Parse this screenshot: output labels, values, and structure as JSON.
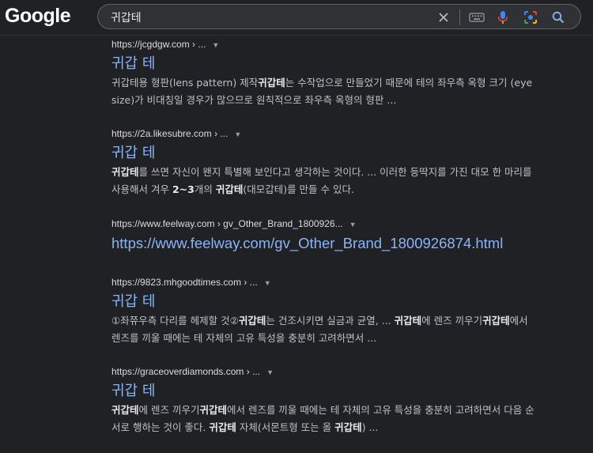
{
  "header": {
    "logo_text": "Google",
    "search_value": "귀갑테",
    "icons": [
      "clear-icon",
      "keyboard-icon",
      "microphone-icon",
      "lens-icon",
      "search-icon"
    ]
  },
  "results": [
    {
      "cite_url": "https://jcgdgw.com",
      "cite_suffix": " › ...",
      "title": "귀갑 테",
      "snippet": [
        {
          "t": "귀갑테용 형판(lens pattern) 제작",
          "b": false
        },
        {
          "t": "귀갑테",
          "b": true
        },
        {
          "t": "는 수작업으로 만들었기 때문에 테의 좌우측 옥형 크기 (eye size)가 비대칭일 경우가 많으므로 원칙적으로 좌우측 옥형의 형판 ...",
          "b": false
        }
      ]
    },
    {
      "cite_url": "https://2a.likesubre.com",
      "cite_suffix": " › ...",
      "title": "귀갑 테",
      "snippet": [
        {
          "t": "귀갑테",
          "b": true
        },
        {
          "t": "를 쓰면 자신이 왠지 특별해 보인다고 생각하는 것이다. ... 이러한 등딱지를 가진 대모 한 마리를 사용해서 겨우 ",
          "b": false
        },
        {
          "t": "2~3",
          "b": true
        },
        {
          "t": "개의 ",
          "b": false
        },
        {
          "t": "귀갑테",
          "b": true
        },
        {
          "t": "(대모갑테)를 만들 수 있다.",
          "b": false
        }
      ]
    },
    {
      "cite_url": "https://www.feelway.com",
      "cite_suffix": " › gv_Other_Brand_1800926...",
      "title": "https://www.feelway.com/gv_Other_Brand_1800926874.html",
      "snippet": []
    },
    {
      "cite_url": "https://9823.mhgoodtimes.com",
      "cite_suffix": " › ...",
      "title": "귀갑 테",
      "snippet": [
        {
          "t": "①좌쮸우측 다리를 헤제할 것②",
          "b": false
        },
        {
          "t": "귀갑테",
          "b": true
        },
        {
          "t": "는 건조시키면 실금과 균열, ... ",
          "b": false
        },
        {
          "t": "귀갑테",
          "b": true
        },
        {
          "t": "에 렌즈 끼우기",
          "b": false
        },
        {
          "t": "귀갑테",
          "b": true
        },
        {
          "t": "에서 렌즈를 끼울 때에는 테 자체의 고유 특성을 충분히 고려하면서 ...",
          "b": false
        }
      ]
    },
    {
      "cite_url": "https://graceoverdiamonds.com",
      "cite_suffix": " › ...",
      "title": "귀갑 테",
      "snippet": [
        {
          "t": "귀갑테",
          "b": true
        },
        {
          "t": "에 렌즈 끼우기",
          "b": false
        },
        {
          "t": "귀갑테",
          "b": true
        },
        {
          "t": "에서 렌즈를 끼울 때에는 테 자체의 고유 특성을 충분히 고려하면서 다음 순서로 행하는 것이 좋다. ",
          "b": false
        },
        {
          "t": "귀갑테",
          "b": true
        },
        {
          "t": " 자체(서몬트형 또는 올 ",
          "b": false
        },
        {
          "t": "귀갑테",
          "b": true
        },
        {
          "t": ") ...",
          "b": false
        }
      ]
    }
  ]
}
